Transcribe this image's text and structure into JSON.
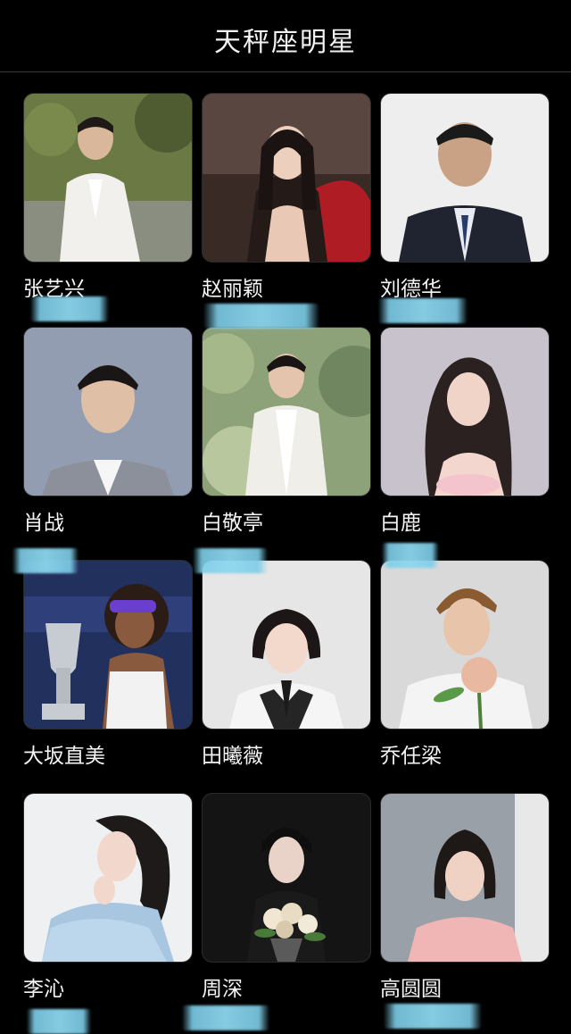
{
  "header": {
    "title": "天秤座明星"
  },
  "cards": [
    {
      "name": "张艺兴",
      "photo": "man-white-suit-photo"
    },
    {
      "name": "赵丽颖",
      "photo": "woman-red-car-photo"
    },
    {
      "name": "刘德华",
      "photo": "man-dark-suit-photo"
    },
    {
      "name": "肖战",
      "photo": "man-grey-suit-photo"
    },
    {
      "name": "白敬亭",
      "photo": "man-white-jacket-photo"
    },
    {
      "name": "白鹿",
      "photo": "woman-long-hair-photo"
    },
    {
      "name": "大坂直美",
      "photo": "tennis-trophy-photo"
    },
    {
      "name": "田曦薇",
      "photo": "woman-school-uniform-photo"
    },
    {
      "name": "乔任梁",
      "photo": "man-holding-flower-photo"
    },
    {
      "name": "李沁",
      "photo": "woman-blue-dress-photo"
    },
    {
      "name": "周深",
      "photo": "man-flower-bouquet-photo"
    },
    {
      "name": "高圆圆",
      "photo": "woman-pink-top-photo"
    }
  ],
  "colors": {
    "background": "#000000",
    "text": "#f4f4f4",
    "redaction": "#8cd6ee"
  }
}
